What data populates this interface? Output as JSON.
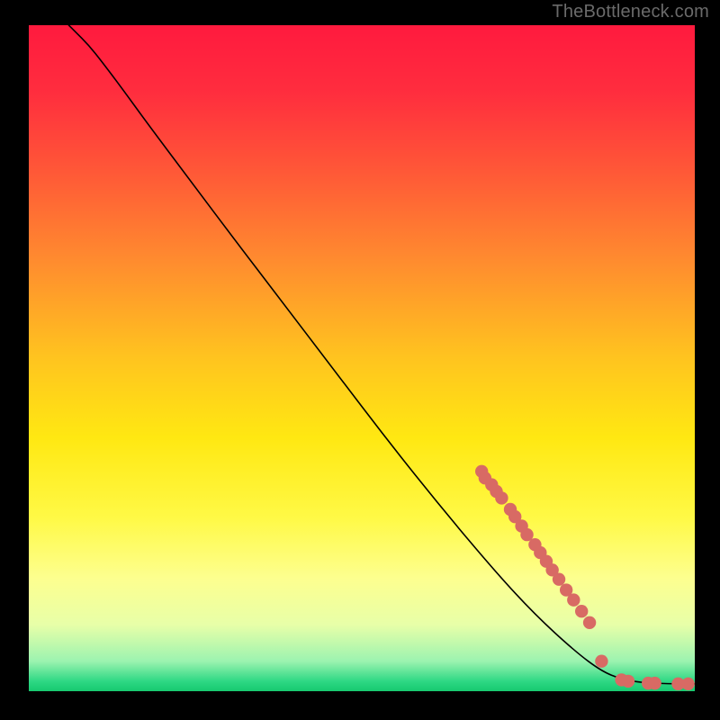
{
  "attribution": "TheBottleneck.com",
  "chart_data": {
    "type": "line",
    "title": "",
    "xlabel": "",
    "ylabel": "",
    "xlim": [
      0,
      100
    ],
    "ylim": [
      0,
      100
    ],
    "background_gradient": {
      "stops": [
        {
          "offset": 0.0,
          "color": "#ff1a3e"
        },
        {
          "offset": 0.1,
          "color": "#ff2d3e"
        },
        {
          "offset": 0.22,
          "color": "#ff5837"
        },
        {
          "offset": 0.35,
          "color": "#ff8a2f"
        },
        {
          "offset": 0.5,
          "color": "#ffc41f"
        },
        {
          "offset": 0.62,
          "color": "#ffe812"
        },
        {
          "offset": 0.74,
          "color": "#fff946"
        },
        {
          "offset": 0.83,
          "color": "#fdff8f"
        },
        {
          "offset": 0.9,
          "color": "#e8ffa8"
        },
        {
          "offset": 0.955,
          "color": "#9cf3b0"
        },
        {
          "offset": 0.985,
          "color": "#2ed884"
        },
        {
          "offset": 1.0,
          "color": "#17c96f"
        }
      ]
    },
    "series": [
      {
        "name": "curve",
        "stroke": "#000000",
        "stroke_width": 1.6,
        "points": [
          {
            "x": 6.0,
            "y": 100.0
          },
          {
            "x": 7.0,
            "y": 99.0
          },
          {
            "x": 9.0,
            "y": 97.0
          },
          {
            "x": 11.0,
            "y": 94.5
          },
          {
            "x": 14.0,
            "y": 90.5
          },
          {
            "x": 18.0,
            "y": 85.0
          },
          {
            "x": 24.0,
            "y": 77.0
          },
          {
            "x": 30.0,
            "y": 69.0
          },
          {
            "x": 38.0,
            "y": 58.5
          },
          {
            "x": 46.0,
            "y": 48.0
          },
          {
            "x": 54.0,
            "y": 37.5
          },
          {
            "x": 62.0,
            "y": 27.5
          },
          {
            "x": 70.0,
            "y": 18.0
          },
          {
            "x": 76.0,
            "y": 11.5
          },
          {
            "x": 82.0,
            "y": 6.0
          },
          {
            "x": 86.0,
            "y": 3.0
          },
          {
            "x": 89.0,
            "y": 1.8
          },
          {
            "x": 92.0,
            "y": 1.3
          },
          {
            "x": 96.0,
            "y": 1.1
          },
          {
            "x": 100.0,
            "y": 1.1
          }
        ]
      }
    ],
    "markers": {
      "fill": "#d86a64",
      "radius": 7.2,
      "points": [
        {
          "x": 68.0,
          "y": 33.0
        },
        {
          "x": 68.5,
          "y": 32.0
        },
        {
          "x": 69.5,
          "y": 31.0
        },
        {
          "x": 70.2,
          "y": 30.0
        },
        {
          "x": 71.0,
          "y": 29.0
        },
        {
          "x": 72.3,
          "y": 27.3
        },
        {
          "x": 73.0,
          "y": 26.2
        },
        {
          "x": 74.0,
          "y": 24.8
        },
        {
          "x": 74.8,
          "y": 23.5
        },
        {
          "x": 76.0,
          "y": 22.0
        },
        {
          "x": 76.8,
          "y": 20.8
        },
        {
          "x": 77.7,
          "y": 19.5
        },
        {
          "x": 78.6,
          "y": 18.2
        },
        {
          "x": 79.6,
          "y": 16.8
        },
        {
          "x": 80.7,
          "y": 15.2
        },
        {
          "x": 81.8,
          "y": 13.7
        },
        {
          "x": 83.0,
          "y": 12.0
        },
        {
          "x": 84.2,
          "y": 10.3
        },
        {
          "x": 86.0,
          "y": 4.5
        },
        {
          "x": 89.0,
          "y": 1.7
        },
        {
          "x": 90.0,
          "y": 1.5
        },
        {
          "x": 93.0,
          "y": 1.2
        },
        {
          "x": 94.0,
          "y": 1.2
        },
        {
          "x": 97.5,
          "y": 1.1
        },
        {
          "x": 99.0,
          "y": 1.1
        }
      ]
    }
  }
}
